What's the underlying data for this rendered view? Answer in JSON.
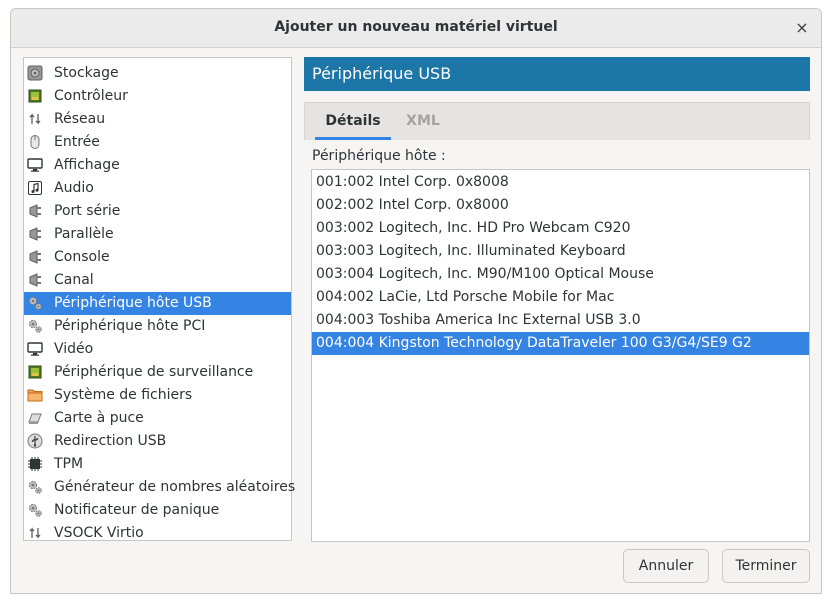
{
  "window": {
    "title": "Ajouter un nouveau matériel virtuel",
    "close_glyph": "×"
  },
  "sidebar": {
    "items": [
      {
        "label": "Stockage",
        "icon": "disk-icon"
      },
      {
        "label": "Contrôleur",
        "icon": "chip-icon"
      },
      {
        "label": "Réseau",
        "icon": "network-icon"
      },
      {
        "label": "Entrée",
        "icon": "mouse-icon"
      },
      {
        "label": "Affichage",
        "icon": "monitor-icon"
      },
      {
        "label": "Audio",
        "icon": "audio-icon"
      },
      {
        "label": "Port série",
        "icon": "plug-icon"
      },
      {
        "label": "Parallèle",
        "icon": "plug-icon"
      },
      {
        "label": "Console",
        "icon": "plug-icon"
      },
      {
        "label": "Canal",
        "icon": "plug-icon"
      },
      {
        "label": "Périphérique hôte USB",
        "icon": "gears-icon",
        "selected": true
      },
      {
        "label": "Périphérique hôte PCI",
        "icon": "gears-icon"
      },
      {
        "label": "Vidéo",
        "icon": "monitor-icon"
      },
      {
        "label": "Périphérique de surveillance",
        "icon": "chip-icon"
      },
      {
        "label": "Système de fichiers",
        "icon": "folder-icon"
      },
      {
        "label": "Carte à puce",
        "icon": "card-icon"
      },
      {
        "label": "Redirection USB",
        "icon": "usb-icon"
      },
      {
        "label": "TPM",
        "icon": "tpm-icon"
      },
      {
        "label": "Générateur de nombres aléatoires",
        "icon": "gears-icon"
      },
      {
        "label": "Notificateur de panique",
        "icon": "gears-icon"
      },
      {
        "label": "VSOCK Virtio",
        "icon": "network-icon"
      }
    ]
  },
  "header": {
    "title": "Périphérique USB",
    "color": "#1c77a8"
  },
  "tabs": [
    {
      "label": "Détails",
      "active": true
    },
    {
      "label": "XML",
      "active": false
    }
  ],
  "details": {
    "host_device_label": "Périphérique hôte :",
    "devices": [
      {
        "label": "001:002 Intel Corp. 0x8008"
      },
      {
        "label": "002:002 Intel Corp. 0x8000"
      },
      {
        "label": "003:002 Logitech, Inc. HD Pro Webcam C920"
      },
      {
        "label": "003:003 Logitech, Inc. Illuminated Keyboard"
      },
      {
        "label": "003:004 Logitech, Inc. M90/M100 Optical Mouse"
      },
      {
        "label": "004:002 LaCie, Ltd Porsche Mobile for Mac"
      },
      {
        "label": "004:003 Toshiba America Inc External USB 3.0"
      },
      {
        "label": "004:004 Kingston Technology DataTraveler 100 G3/G4/SE9 G2",
        "selected": true
      }
    ]
  },
  "buttons": {
    "cancel": "Annuler",
    "finish": "Terminer"
  },
  "colors": {
    "selection": "#3584e4",
    "accent": "#1c77a8"
  }
}
